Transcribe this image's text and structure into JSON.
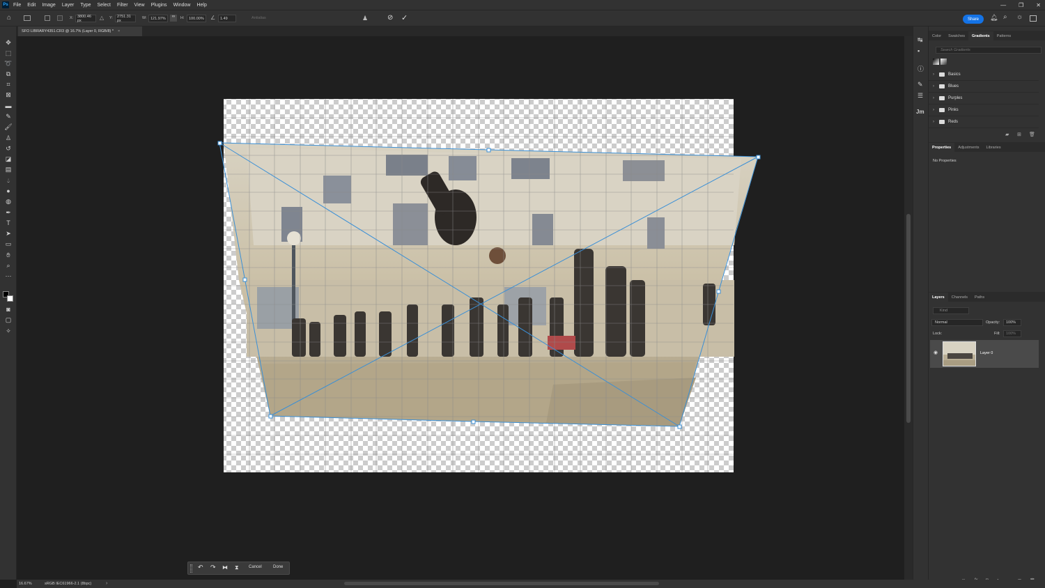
{
  "app": {
    "logo": "Ps"
  },
  "menu": [
    "File",
    "Edit",
    "Image",
    "Layer",
    "Type",
    "Select",
    "Filter",
    "View",
    "Plugins",
    "Window",
    "Help"
  ],
  "window_controls": {
    "minimize": "—",
    "restore": "❐",
    "close": "✕"
  },
  "options": {
    "x_label": "X:",
    "x_value": "3800.46 px",
    "y_label": "Y:",
    "y_value": "2751.31 px",
    "w_label": "W:",
    "w_value": "121.97%",
    "h_label": "H:",
    "h_value": "100.00%",
    "angle_value": "1.49",
    "antialias_label": "Antialias",
    "share_label": "Share"
  },
  "document": {
    "tab_title": "SFO LIBRARY4351.CR3 @ 16.7% (Layer 0, RGB/8) *"
  },
  "status": {
    "zoom": "16.67%",
    "profile": "sRGB IEC61966-2.1 (8bpc)"
  },
  "context_bar": {
    "cancel": "Cancel",
    "done": "Done"
  },
  "panels": {
    "top_tabs": [
      "Color",
      "Swatches",
      "Gradients",
      "Patterns"
    ],
    "top_active": "Gradients",
    "search_placeholder": "Search Gradients",
    "gradient_folders": [
      "Basics",
      "Blues",
      "Purples",
      "Pinks",
      "Reds"
    ],
    "mid_tabs": [
      "Properties",
      "Adjustments",
      "Libraries"
    ],
    "mid_active": "Properties",
    "no_properties": "No Properties",
    "layer_tabs": [
      "Layers",
      "Channels",
      "Paths"
    ],
    "layer_active": "Layers",
    "kind_placeholder": "Kind",
    "blend_mode": "Normal",
    "opacity_label": "Opacity:",
    "opacity_value": "100%",
    "lock_label": "Lock:",
    "fill_label": "Fill:",
    "fill_value": "100%",
    "layer_name": "Layer 0"
  },
  "colors": {
    "accent": "#1473e6",
    "guide": "#3a8fd6",
    "panel": "#323232",
    "canvas_bg": "#1f1f1f"
  }
}
